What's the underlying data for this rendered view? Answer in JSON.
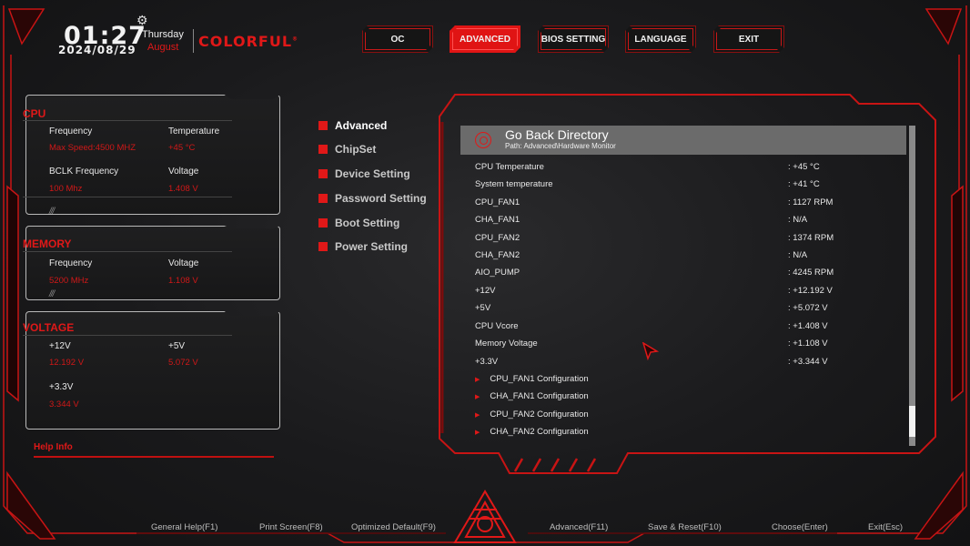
{
  "clock": {
    "time": "01:27",
    "date": "2024/08/29",
    "day": "Thursday",
    "month": "August"
  },
  "brand": {
    "name": "COLORFUL",
    "mark": "®"
  },
  "nav": {
    "oc": "OC",
    "advanced": "ADVANCED",
    "bios": "BIOS SETTING",
    "language": "LANGUAGE",
    "exit": "EXIT",
    "active": "ADVANCED"
  },
  "cpu": {
    "title": "CPU",
    "freq_label": "Frequency",
    "freq": "Max Speed:4500 MHZ",
    "temp_label": "Temperature",
    "temp": "+45 °C",
    "bclk_label": "BCLK Frequency",
    "bclk": "100 Mhz",
    "volt_label": "Voltage",
    "volt": "1.408 V"
  },
  "memory": {
    "title": "MEMORY",
    "freq_label": "Frequency",
    "freq": "5200 MHz",
    "volt_label": "Voltage",
    "volt": "1.108 V"
  },
  "voltage": {
    "title": "VOLTAGE",
    "v12_label": "+12V",
    "v12": "12.192 V",
    "v5_label": "+5V",
    "v5": "5.072 V",
    "v33_label": "+3.3V",
    "v33": "3.344 V"
  },
  "help_info": "Help Info",
  "menu": [
    "Advanced",
    "ChipSet",
    "Device Setting",
    "Password Setting",
    "Boot Setting",
    "Power Setting"
  ],
  "goback": {
    "title": "Go Back Directory",
    "path": "Path: Advanced\\Hardware Monitor"
  },
  "monitor": [
    {
      "label": "CPU Temperature",
      "value": ": +45 °C"
    },
    {
      "label": "System temperature",
      "value": ": +41 °C"
    },
    {
      "label": "CPU_FAN1",
      "value": ": 1127 RPM"
    },
    {
      "label": "CHA_FAN1",
      "value": ": N/A"
    },
    {
      "label": "CPU_FAN2",
      "value": ": 1374 RPM"
    },
    {
      "label": "CHA_FAN2",
      "value": ": N/A"
    },
    {
      "label": "AIO_PUMP",
      "value": ": 4245 RPM"
    },
    {
      "label": "+12V",
      "value": ": +12.192 V"
    },
    {
      "label": "+5V",
      "value": ": +5.072 V"
    },
    {
      "label": "CPU Vcore",
      "value": ": +1.408 V"
    },
    {
      "label": "Memory Voltage",
      "value": ": +1.108 V"
    },
    {
      "label": "+3.3V",
      "value": ": +3.344 V"
    }
  ],
  "configs": [
    "CPU_FAN1 Configuration",
    "CHA_FAN1 Configuration",
    "CPU_FAN2 Configuration",
    "CHA_FAN2 Configuration"
  ],
  "hints": [
    "General Help(F1)",
    "Print Screen(F8)",
    "Optimized Default(F9)",
    "Advanced(F11)",
    "Save & Reset(F10)",
    "Choose(Enter)",
    "Exit(Esc)"
  ],
  "colors": {
    "accent": "#e01818",
    "background": "#1a1a1c",
    "header_bar": "#6b6b6b"
  }
}
